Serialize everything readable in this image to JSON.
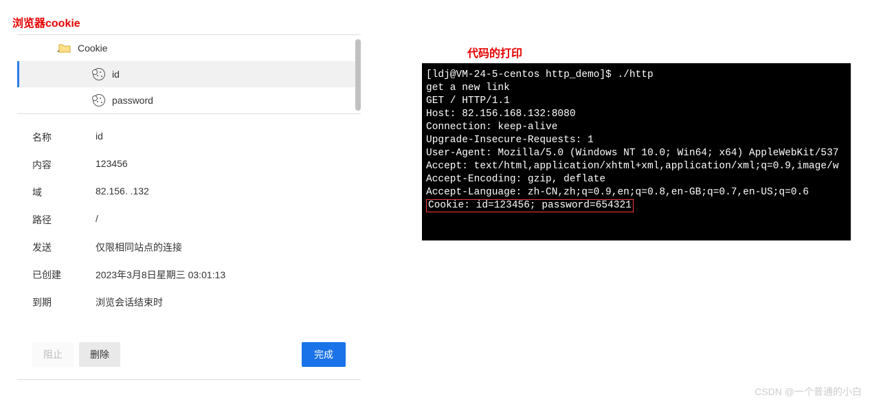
{
  "titles": {
    "browser_cookie": "浏览器cookie",
    "code_print": "代码的打印"
  },
  "tree": {
    "root": "Cookie",
    "items": [
      {
        "label": "id"
      },
      {
        "label": "password"
      }
    ]
  },
  "details": {
    "labels": {
      "name": "名称",
      "content": "内容",
      "domain": "域",
      "path": "路径",
      "send": "发送",
      "created": "已创建",
      "expires": "到期"
    },
    "values": {
      "name": "id",
      "content": "123456",
      "domain": "82.156.    .132",
      "path": "/",
      "send": "仅限相同站点的连接",
      "created": "2023年3月8日星期三 03:01:13",
      "expires": "浏览会话结束时"
    }
  },
  "buttons": {
    "block": "阻止",
    "delete": "删除",
    "done": "完成"
  },
  "terminal": {
    "lines": [
      "[ldj@VM-24-5-centos http_demo]$ ./http",
      "get a new link",
      "GET / HTTP/1.1",
      "Host: 82.156.168.132:8080",
      "Connection: keep-alive",
      "Upgrade-Insecure-Requests: 1",
      "User-Agent: Mozilla/5.0 (Windows NT 10.0; Win64; x64) AppleWebKit/537",
      "Accept: text/html,application/xhtml+xml,application/xml;q=0.9,image/w",
      "Accept-Encoding: gzip, deflate",
      "Accept-Language: zh-CN,zh;q=0.9,en;q=0.8,en-GB;q=0.7,en-US;q=0.6"
    ],
    "highlight": "Cookie: id=123456; password=654321"
  },
  "watermark": "CSDN @一个普通的小白"
}
